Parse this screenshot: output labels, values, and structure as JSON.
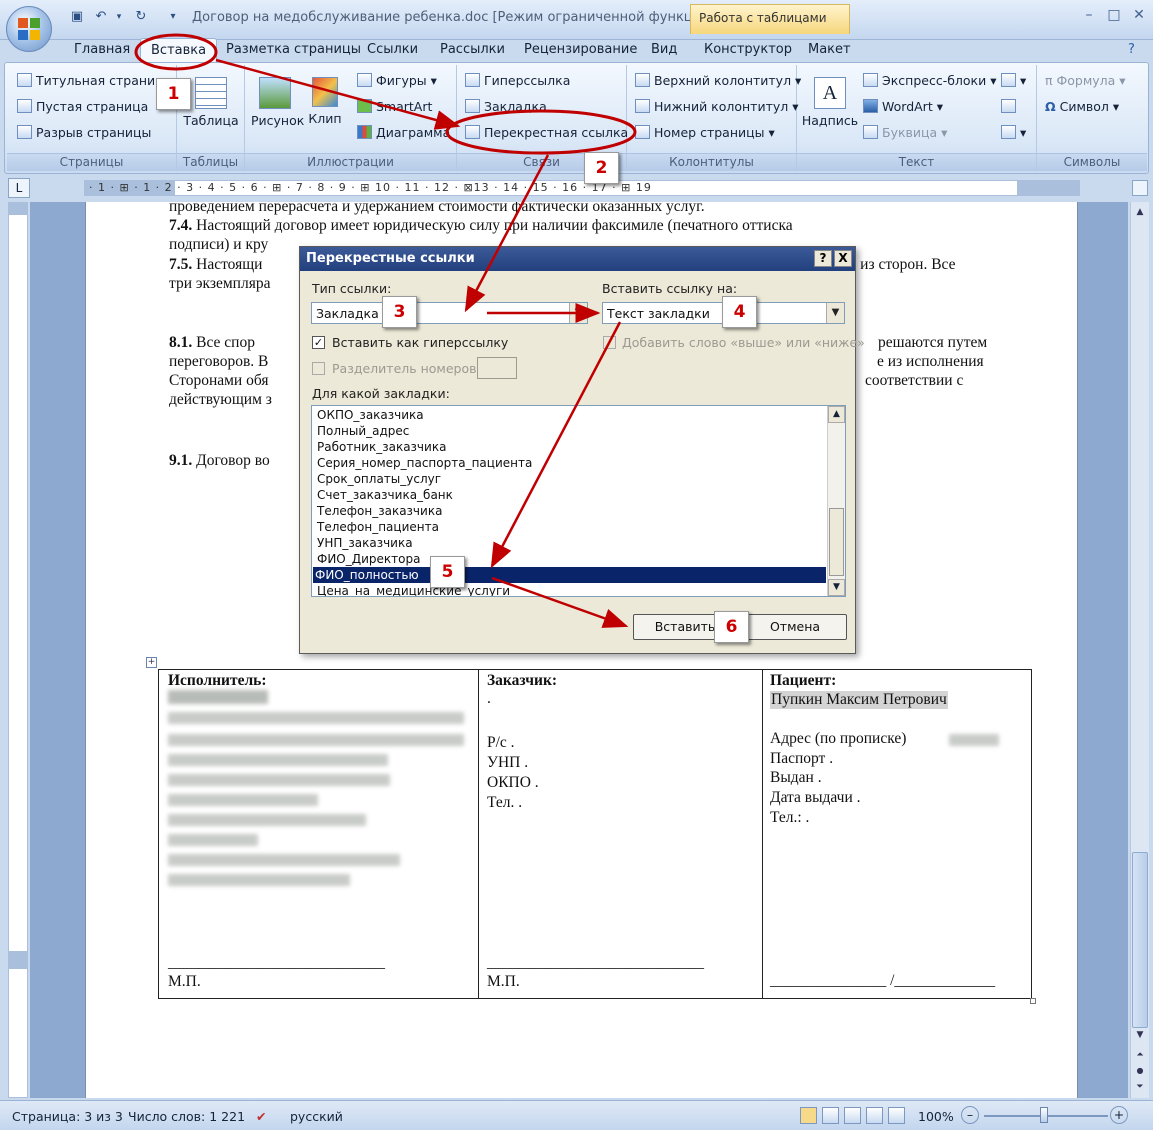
{
  "window": {
    "title": "Договор на медобслуживание ребенка.doc [Режим ограниченной функци...",
    "context_tab_title": "Работа с таблицами",
    "buttons": [
      "–",
      "□",
      "✕"
    ]
  },
  "tabs": [
    "Главная",
    "Вставка",
    "Разметка страницы",
    "Ссылки",
    "Рассылки",
    "Рецензирование",
    "Вид",
    "Конструктор",
    "Макет"
  ],
  "ribbon": {
    "pages": {
      "label": "Страницы",
      "items": [
        "Титульная страница",
        "Пустая страница",
        "Разрыв страницы"
      ]
    },
    "tables": {
      "label": "Таблицы",
      "button": "Таблица"
    },
    "illustrations": {
      "label": "Иллюстрации",
      "picture": "Рисунок",
      "clip": "Клип",
      "items": [
        "Фигуры",
        "SmartArt",
        "Диаграмма"
      ]
    },
    "links": {
      "label": "Связи",
      "items": [
        "Гиперссылка",
        "Закладка",
        "Перекрестная ссылка"
      ]
    },
    "header_footer": {
      "label": "Колонтитулы",
      "items": [
        "Верхний колонтитул",
        "Нижний колонтитул",
        "Номер страницы"
      ]
    },
    "text": {
      "label": "Текст",
      "textbox": "Надпись",
      "items": [
        "Экспресс-блоки",
        "WordArt",
        "Буквица"
      ]
    },
    "symbols": {
      "label": "Символы",
      "items": [
        "Формула",
        "Символ"
      ]
    }
  },
  "ruler": {
    "corner": "L",
    "numbers": "· 1 · ⊞ · 1 · 2 · 3 · 4 · 5 · 6 · ⊞ · 7 · 8 · 9 · ⊞ 10 · 11 · 12 · ⊠13 · 14 · 15 · 16 · 17 · ⊞ 19"
  },
  "document": {
    "lines": [
      {
        "text": "проведением перерасчета и удержанием стоимости фактически оказанных услуг."
      },
      {
        "num": "7.4.",
        "text": " Настоящий договор имеет юридическую силу при наличии факсимиле (печатного оттиска"
      },
      {
        "text": "подписи) и кру"
      },
      {
        "num": "7.5.",
        "text": " Настоящи"
      },
      {
        "text": "й из сторон. Все"
      },
      {
        "text": "три экземпляра"
      },
      {
        "num": "8.1.",
        "text": "     Все спор"
      },
      {
        "text": "решаются путем"
      },
      {
        "text": "переговоров. В"
      },
      {
        "text": "е из исполнения"
      },
      {
        "text": "Сторонами обя"
      },
      {
        "text": "соответствии с"
      },
      {
        "text": "действующим з"
      },
      {
        "num": "9.1.",
        "text": " Договор во"
      }
    ]
  },
  "sig_table": {
    "executor": {
      "title": "Исполнитель:",
      "stamp": "М.П.",
      "line": "____________________________"
    },
    "customer": {
      "title": "Заказчик:",
      "dot": ".",
      "fields": [
        "Р/с .",
        "УНП .",
        "ОКПО .",
        "Тел. ."
      ],
      "stamp": "М.П.",
      "line": "____________________________"
    },
    "patient": {
      "title": "Пациент:",
      "name": "Пупкин Максим Петрович",
      "fields": [
        "Адрес (по прописке)",
        "Паспорт .",
        "Выдан .",
        "Дата выдачи .",
        "Тел.: ."
      ],
      "line": "_______________ /_____________"
    }
  },
  "dialog": {
    "title": "Перекрестные ссылки",
    "help": "?",
    "close": "X",
    "ref_type_label": "Тип ссылки:",
    "ref_type_value": "Закладка",
    "insert_ref_label": "Вставить ссылку на:",
    "insert_ref_value": "Текст закладки",
    "hyperlink_chk": "Вставить как гиперссылку",
    "above_below_chk": "Добавить слово «выше» или «ниже»",
    "separator_chk": "Разделитель номеров",
    "which_label": "Для какой закладки:",
    "bookmarks": [
      "ОКПО_заказчика",
      "Полный_адрес",
      "Работник_заказчика",
      "Серия_номер_паспорта_пациента",
      "Срок_оплаты_услуг",
      "Счет_заказчика_банк",
      "Телефон_заказчика",
      "Телефон_пациента",
      "УНП_заказчика",
      "ФИО_Директора",
      "ФИО_полностью",
      "Цена_на_медицинские_услуги"
    ],
    "selected_index": 10,
    "insert_btn": "Вставить",
    "cancel_btn": "Отмена"
  },
  "callouts": [
    "1",
    "2",
    "3",
    "4",
    "5",
    "6"
  ],
  "statusbar": {
    "page": "Страница: 3 из 3",
    "words": "Число слов: 1 221",
    "lang": "русский",
    "zoom": "100%",
    "minus": "–",
    "plus": "+"
  },
  "colors": {
    "annotation": "#c00000",
    "dialog_title": "#23407e",
    "selection": "#0a246a"
  }
}
